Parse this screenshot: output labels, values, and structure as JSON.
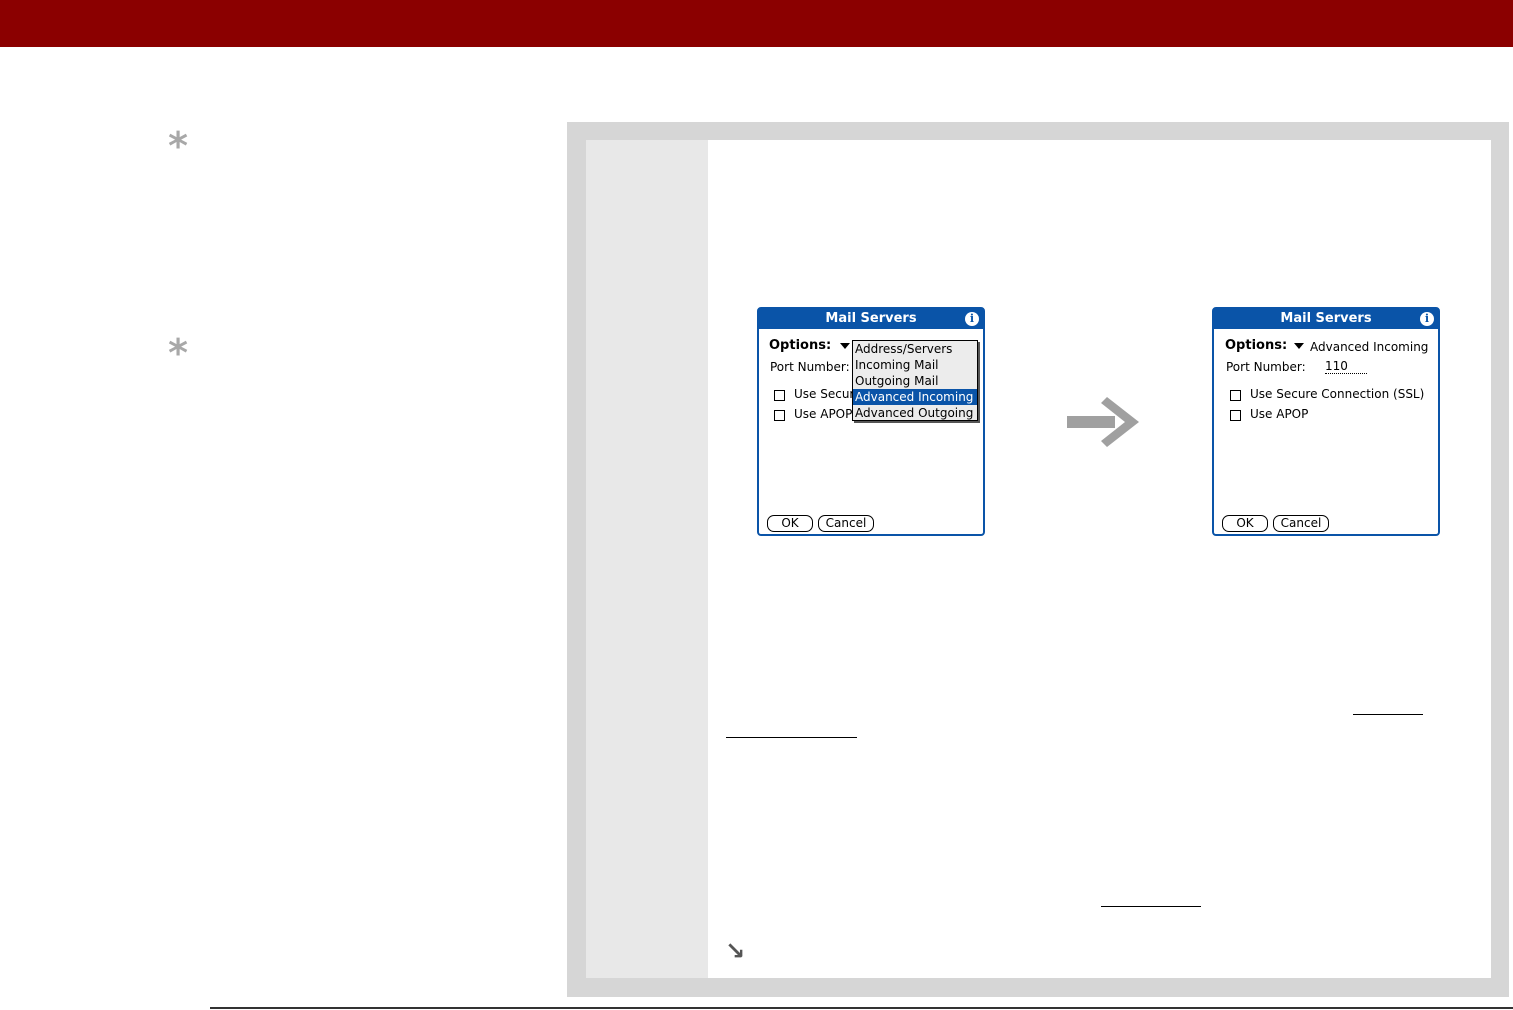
{
  "colors": {
    "header_bar": "#8b0000",
    "dialog_blue": "#0a54a8",
    "asterisk_gray": "#a8a8a8",
    "arrow_gray": "#a0a0a0"
  },
  "icons": {
    "tip": "asterisk-icon",
    "transition": "right-arrow-icon",
    "continue": "down-right-arrow-icon",
    "info": "info-icon",
    "dropdown": "triangle-down-icon"
  },
  "dialog_left": {
    "title": "Mail Servers",
    "options_label": "Options:",
    "port_label": "Port Number:",
    "checkbox_ssl_label": "Use Secure",
    "checkbox_apop_label": "Use APOP",
    "menu_items": [
      "Address/Servers",
      "Incoming Mail",
      "Outgoing Mail",
      "Advanced Incoming",
      "Advanced Outgoing"
    ],
    "menu_selected": "Advanced Incoming",
    "ok_label": "OK",
    "cancel_label": "Cancel"
  },
  "dialog_right": {
    "title": "Mail Servers",
    "options_label": "Options:",
    "options_value": "Advanced Incoming",
    "port_label": "Port Number:",
    "port_value": "110",
    "checkbox_ssl_label": "Use Secure Connection (SSL)",
    "checkbox_apop_label": "Use APOP",
    "ok_label": "OK",
    "cancel_label": "Cancel"
  }
}
